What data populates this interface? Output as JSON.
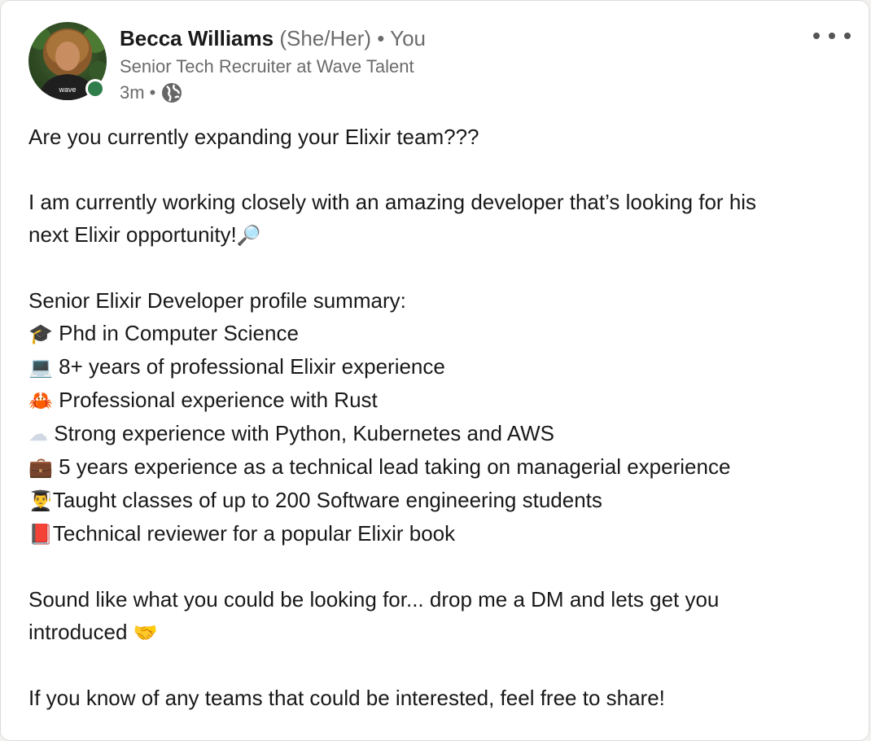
{
  "author": {
    "name": "Becca Williams",
    "pronouns": "(She/Her)",
    "separator": "•",
    "relation": "You",
    "headline": "Senior Tech Recruiter at Wave Talent",
    "time": "3m",
    "visibility_icon": "globe-icon",
    "avatar_text": "wave",
    "presence_color": "#2f7d4a"
  },
  "menu": {
    "icon": "more-horizontal-icon"
  },
  "post": {
    "line1": "Are you currently expanding your Elixir team???",
    "line2a": "I am currently working closely with an amazing developer that’s looking for his",
    "line2b": "next Elixir opportunity!",
    "line2b_emoji": "🔎",
    "summary_title": "Senior Elixir Developer profile summary:",
    "bullets": [
      {
        "emoji": "🎓",
        "text": " Phd in Computer Science"
      },
      {
        "emoji": "💻",
        "text": " 8+ years of professional Elixir experience"
      },
      {
        "emoji": "🦀",
        "text": " Professional experience with Rust"
      },
      {
        "emoji": "☁",
        "text": " Strong experience with Python, Kubernetes and AWS"
      },
      {
        "emoji": "💼",
        "text": " 5 years experience as a technical lead taking on managerial experience"
      },
      {
        "emoji": "👨‍🎓",
        "text": "Taught classes of up to 200 Software engineering students"
      },
      {
        "emoji": "📕",
        "text": "Technical reviewer for a popular Elixir book"
      }
    ],
    "closing1a": "Sound like what you could be looking for... drop me a DM and lets get you",
    "closing1b": "introduced ",
    "closing1b_emoji": "🤝",
    "closing2": "If you know of any teams that could be interested, feel free to share!"
  }
}
